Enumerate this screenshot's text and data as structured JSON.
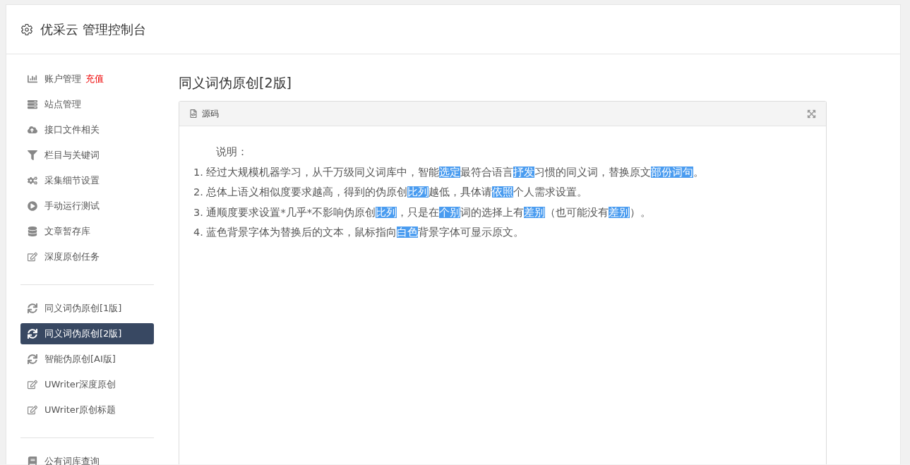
{
  "header": {
    "title": "优采云 管理控制台"
  },
  "sidebar": {
    "groups": [
      {
        "items": [
          {
            "kind": "chart",
            "label": "账户管理",
            "badge": "充值",
            "selected": false
          },
          {
            "kind": "server",
            "label": "站点管理",
            "selected": false
          },
          {
            "kind": "cloud",
            "label": "接口文件相关",
            "selected": false
          },
          {
            "kind": "filter",
            "label": "栏目与关键词",
            "selected": false
          },
          {
            "kind": "cogs",
            "label": "采集细节设置",
            "selected": false
          },
          {
            "kind": "play",
            "label": "手动运行测试",
            "selected": false
          },
          {
            "kind": "database",
            "label": "文章暂存库",
            "selected": false
          },
          {
            "kind": "edit",
            "label": "深度原创任务",
            "selected": false
          }
        ]
      },
      {
        "items": [
          {
            "kind": "refresh",
            "label": "同义词伪原创[1版]",
            "selected": false
          },
          {
            "kind": "refresh",
            "label": "同义词伪原创[2版]",
            "selected": true
          },
          {
            "kind": "refresh",
            "label": "智能伪原创[AI版]",
            "selected": false
          },
          {
            "kind": "edit",
            "label": "UWriter深度原创",
            "selected": false
          },
          {
            "kind": "edit",
            "label": "UWriter原创标题",
            "selected": false
          }
        ]
      },
      {
        "items": [
          {
            "kind": "book",
            "label": "公有词库查询",
            "selected": false
          }
        ]
      }
    ]
  },
  "main": {
    "title": "同义词伪原创[2版]",
    "editor": {
      "toolbar_label": "源码",
      "heading": "说明：",
      "lines": [
        [
          {
            "text": "1. 经过大规模机器学习，从千万级同义词库中，智能",
            "replaced": false
          },
          {
            "text": "选定",
            "replaced": true
          },
          {
            "text": "最符合语言",
            "replaced": false
          },
          {
            "text": "抒发",
            "replaced": true
          },
          {
            "text": "习惯的同义词，替换原文",
            "replaced": false
          },
          {
            "text": "部份",
            "replaced": true
          },
          {
            "text": "词句",
            "replaced": true
          },
          {
            "text": "。",
            "replaced": false
          }
        ],
        [
          {
            "text": "2. 总体上语义相似度要求越高，得到的伪原创",
            "replaced": false
          },
          {
            "text": "比列",
            "replaced": true
          },
          {
            "text": "越低，具体请",
            "replaced": false
          },
          {
            "text": "依照",
            "replaced": true
          },
          {
            "text": "个人需求设置。",
            "replaced": false
          }
        ],
        [
          {
            "text": "3. 通顺度要求设置*几乎*不影响伪原创",
            "replaced": false
          },
          {
            "text": "比列",
            "replaced": true
          },
          {
            "text": "，只是在",
            "replaced": false
          },
          {
            "text": "个别",
            "replaced": true
          },
          {
            "text": "词的选择上有",
            "replaced": false
          },
          {
            "text": "差别",
            "replaced": true
          },
          {
            "text": "（也可能没有",
            "replaced": false
          },
          {
            "text": "差别",
            "replaced": true
          },
          {
            "text": "）。",
            "replaced": false
          }
        ],
        [
          {
            "text": "4. 蓝色背景字体为替换后的文本，鼠标指向",
            "replaced": false
          },
          {
            "text": "白色",
            "replaced": true
          },
          {
            "text": "背景字体可显示原文。",
            "replaced": false
          }
        ]
      ]
    }
  }
}
